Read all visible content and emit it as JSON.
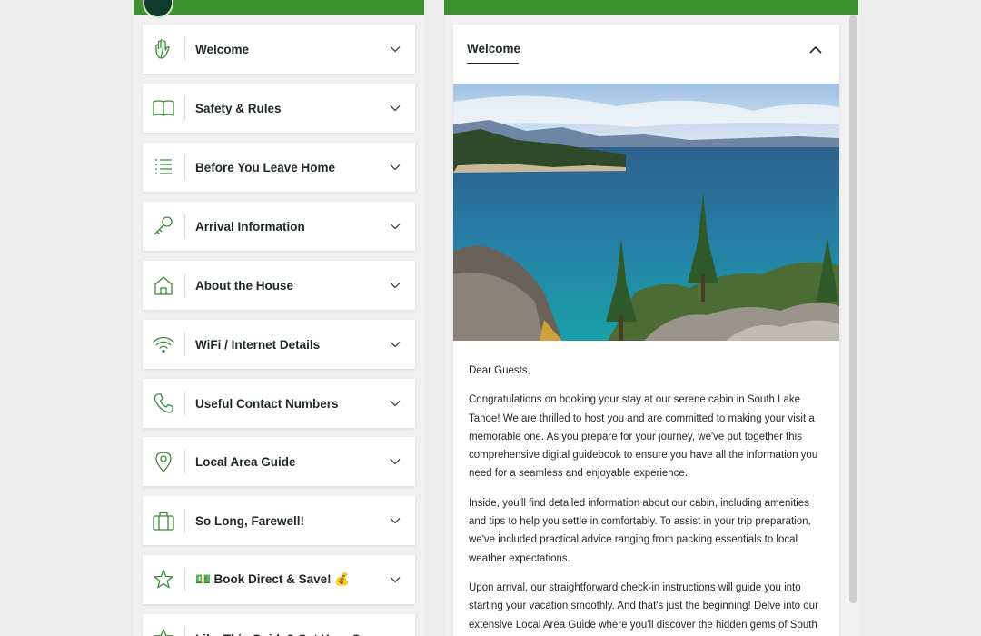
{
  "sidebar": {
    "items": [
      {
        "label": "Welcome",
        "icon": "hand-icon"
      },
      {
        "label": "Safety & Rules",
        "icon": "book-icon"
      },
      {
        "label": "Before You Leave Home",
        "icon": "checklist-icon"
      },
      {
        "label": "Arrival Information",
        "icon": "key-icon"
      },
      {
        "label": "About the House",
        "icon": "house-icon"
      },
      {
        "label": "WiFi / Internet Details",
        "icon": "wifi-icon"
      },
      {
        "label": "Useful Contact Numbers",
        "icon": "phone-icon"
      },
      {
        "label": "Local Area Guide",
        "icon": "map-pin-icon"
      },
      {
        "label": "So Long, Farewell!",
        "icon": "suitcase-icon"
      },
      {
        "label": "💵 Book Direct & Save! 💰",
        "icon": "star-icon"
      },
      {
        "label": "Like This Guide? Get Your Own",
        "icon": "star-icon"
      }
    ]
  },
  "detail": {
    "title": "Welcome",
    "greeting": "Dear Guests,",
    "paragraphs": [
      "Congratulations on booking your stay at our serene cabin in South Lake Tahoe! We are thrilled to host you and are committed to making your visit a memorable one. As you prepare for your journey, we've put together this comprehensive digital guidebook to ensure you have all the information you need for a seamless and enjoyable experience.",
      "Inside, you'll find detailed information about our cabin, including amenities and tips to help you settle in comfortably. To assist in your trip preparation, we've included practical advice ranging from packing essentials to local weather expectations.",
      "Upon arrival, our straightforward check-in instructions will guide you into starting your vacation smoothly. And that's just the beginning! Delve into our extensive Local Area Guide where you'll discover the hidden gems of South"
    ]
  },
  "colors": {
    "brand_green": "#3f8f33",
    "icon_green": "#3d8a3a",
    "text": "#1f2a24"
  }
}
